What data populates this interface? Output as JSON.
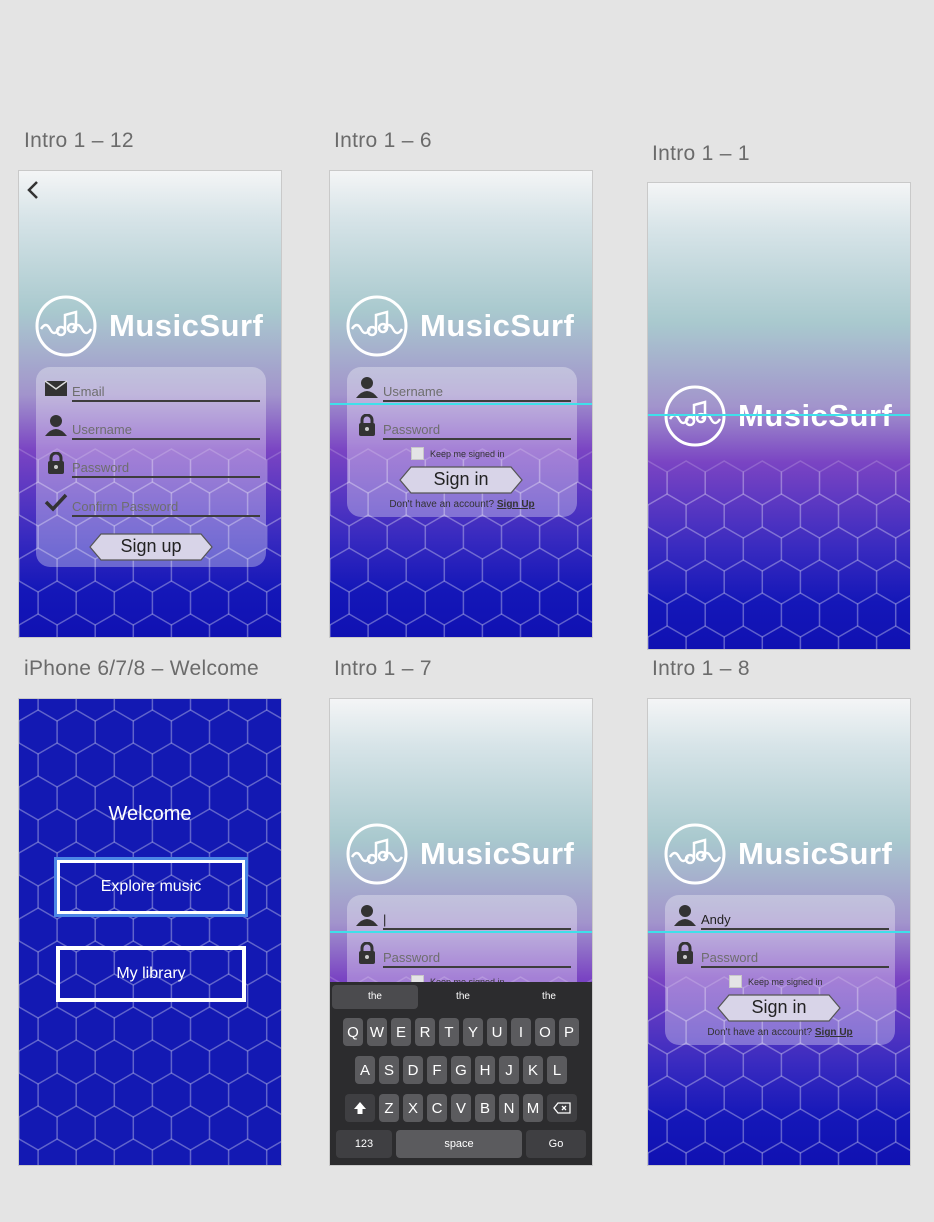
{
  "artboards": {
    "a1": "Intro 1 – 12",
    "a2": "Intro 1 – 6",
    "a3": "Intro 1 – 1",
    "a4": "iPhone 6/7/8 – Welcome",
    "a5": "Intro 1 – 7",
    "a6": "Intro 1 – 8"
  },
  "brand": {
    "name": "MusicSurf",
    "accent": "#1319b3",
    "guide_color": "#3fe0ea"
  },
  "signup": {
    "email": "Email",
    "username": "Username",
    "password": "Password",
    "confirm": "Confirm Password",
    "button": "Sign up"
  },
  "signin": {
    "username": "Username",
    "password": "Password",
    "keep": "Keep me signed in",
    "button": "Sign in",
    "no_account": "Don't have an account?",
    "signup_link": "Sign Up"
  },
  "typing": {
    "username_value": "|",
    "password": "Password",
    "keep": "Keep me signed in"
  },
  "filled": {
    "username_value": "Andy",
    "password": "Password",
    "keep": "Keep me signed in",
    "button": "Sign in",
    "no_account": "Don't have an account?",
    "signup_link": "Sign Up"
  },
  "welcome": {
    "title": "Welcome",
    "explore": "Explore music",
    "library": "My library"
  },
  "keyboard": {
    "suggestions": [
      "the",
      "the",
      "the"
    ],
    "row1": [
      "Q",
      "W",
      "E",
      "R",
      "T",
      "Y",
      "U",
      "I",
      "O",
      "P"
    ],
    "row2": [
      "A",
      "S",
      "D",
      "F",
      "G",
      "H",
      "J",
      "K",
      "L"
    ],
    "row3": [
      "Z",
      "X",
      "C",
      "V",
      "B",
      "N",
      "M"
    ],
    "numbers": "123",
    "space": "space",
    "go": "Go"
  }
}
